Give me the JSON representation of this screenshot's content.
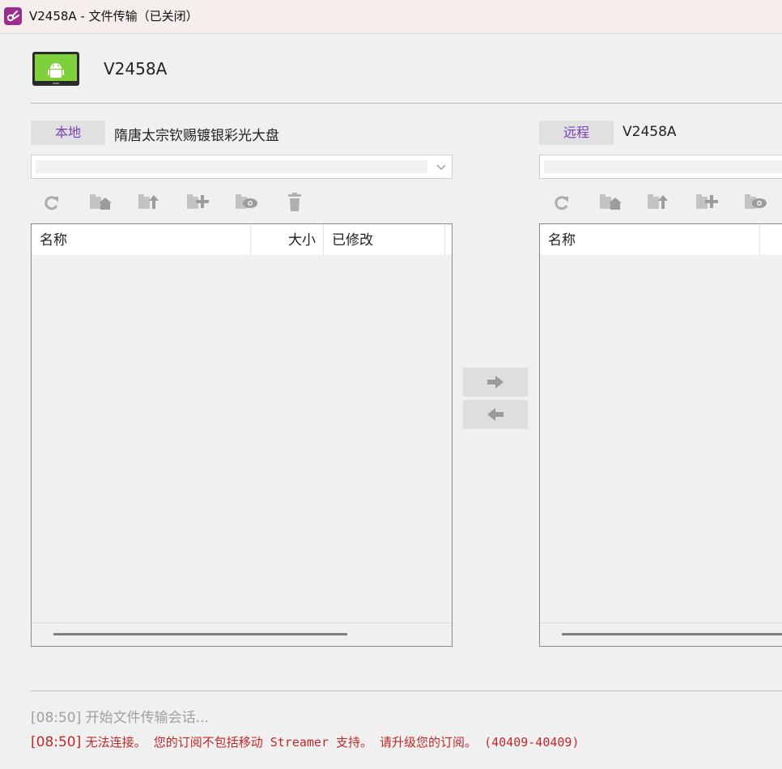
{
  "window": {
    "title": "V2458A - 文件传输（已关闭）"
  },
  "device": {
    "name": "V2458A"
  },
  "local": {
    "tag": "本地",
    "path": "隋唐太宗钦赐镀银彩光大盘",
    "path_input_value": "",
    "columns": {
      "name": "名称",
      "size": "大小",
      "modified": "已修改"
    }
  },
  "remote": {
    "tag": "远程",
    "path": "V2458A",
    "path_input_value": "",
    "columns": {
      "name": "名称"
    }
  },
  "log": [
    {
      "time": "[08:50]",
      "text": "开始文件传输会话...",
      "level": "info"
    },
    {
      "time": "[08:50]",
      "text": "无法连接。 您的订阅不包括移动 Streamer 支持。 请升级您的订阅。 (40409-40409)",
      "level": "error"
    }
  ],
  "colors": {
    "accent_purple": "#7a3fb5",
    "error_red": "#c0282a",
    "info_gray": "#a0a0a0",
    "device_green": "#7fd13b"
  }
}
